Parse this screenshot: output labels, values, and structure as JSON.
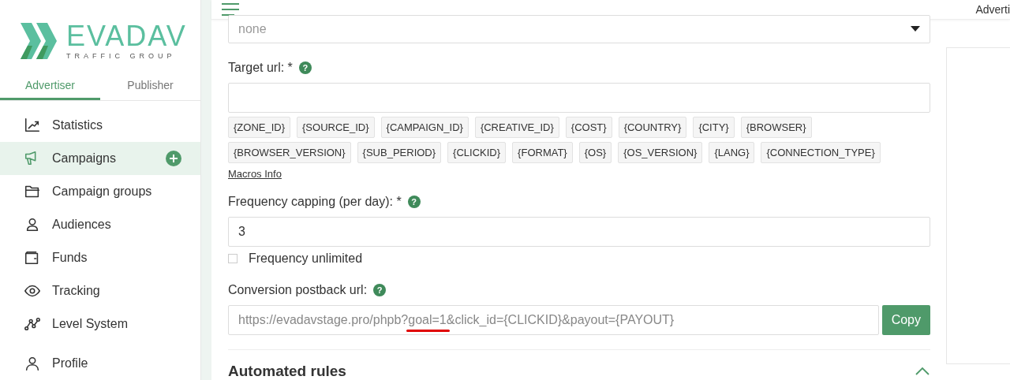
{
  "brand": {
    "name": "EVADAV",
    "tagline": "TRAFFIC GROUP"
  },
  "role_tabs": [
    {
      "label": "Advertiser",
      "selected": true
    },
    {
      "label": "Publisher",
      "selected": false
    }
  ],
  "sidebar": {
    "items": [
      {
        "label": "Statistics",
        "selected": false,
        "add": false
      },
      {
        "label": "Campaigns",
        "selected": true,
        "add": true
      },
      {
        "label": "Campaign groups",
        "selected": false,
        "add": false
      },
      {
        "label": "Audiences",
        "selected": false,
        "add": false
      },
      {
        "label": "Funds",
        "selected": false,
        "add": false
      },
      {
        "label": "Tracking",
        "selected": false,
        "add": false
      },
      {
        "label": "Level System",
        "selected": false,
        "add": false
      },
      {
        "label": "Profile",
        "selected": false,
        "add": false
      }
    ]
  },
  "header": {
    "account_label": "Adverti"
  },
  "form": {
    "select": {
      "value": "none"
    },
    "target_url": {
      "label": "Target url: *",
      "help": "?",
      "macros": [
        [
          "{ZONE_ID}",
          "{SOURCE_ID}",
          "{CAMPAIGN_ID}",
          "{CREATIVE_ID}",
          "{COST}",
          "{COUNTRY}",
          "{CITY}",
          "{BROWSER}"
        ],
        [
          "{BROWSER_VERSION}",
          "{SUB_PERIOD}",
          "{CLICKID}",
          "{FORMAT}",
          "{OS}",
          "{OS_VERSION}",
          "{LANG}",
          "{CONNECTION_TYPE}"
        ]
      ],
      "macros_link": "Macros Info"
    },
    "frequency": {
      "label": "Frequency capping (per day): *",
      "help": "?",
      "value": "3",
      "unlimited_label": "Frequency unlimited",
      "unlimited_checked": false
    },
    "postback": {
      "label": "Conversion postback url:",
      "help": "?",
      "value_parts": [
        {
          "text": "https://evadavstage.pro/phpb?",
          "marked": false
        },
        {
          "text": "goal=1",
          "marked": true
        },
        {
          "text": "&click_id={CLICKID}&payout={PAYOUT}",
          "marked": false
        }
      ],
      "button": "Copy"
    },
    "section": {
      "title": "Automated rules",
      "expanded": true
    }
  }
}
